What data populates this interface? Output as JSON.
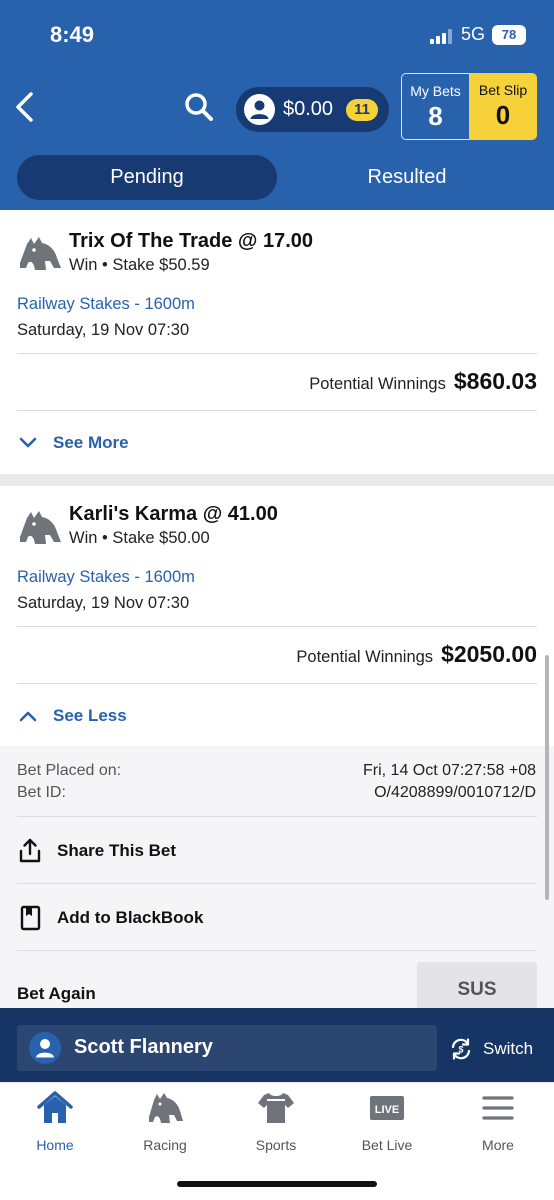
{
  "status_bar": {
    "time": "8:49",
    "network": "5G",
    "battery": "78"
  },
  "header": {
    "balance": "$0.00",
    "balance_badge": "11",
    "my_bets": {
      "label": "My Bets",
      "count": "8"
    },
    "bet_slip": {
      "label": "Bet Slip",
      "count": "0"
    }
  },
  "tabs": [
    {
      "label": "Pending",
      "active": true
    },
    {
      "label": "Resulted",
      "active": false
    }
  ],
  "bets": [
    {
      "title": "Trix Of The Trade @ 17.00",
      "bet_type": "Win",
      "stake": "Stake $50.59",
      "race": "Railway Stakes - 1600m",
      "date": "Saturday, 19 Nov 07:30",
      "potential_label": "Potential Winnings",
      "potential_value": "$860.03",
      "toggle_label": "See More"
    },
    {
      "title": "Karli's Karma @ 41.00",
      "bet_type": "Win",
      "stake": "Stake $50.00",
      "race": "Railway Stakes - 1600m",
      "date": "Saturday, 19 Nov 07:30",
      "potential_label": "Potential Winnings",
      "potential_value": "$2050.00",
      "toggle_label": "See Less"
    }
  ],
  "details": {
    "placed_label": "Bet Placed on:",
    "placed_value": "Fri, 14 Oct 07:27:58 +08",
    "id_label": "Bet ID:",
    "id_value": "O/4208899/0010712/D",
    "share_label": "Share This Bet",
    "blackbook_label": "Add to BlackBook",
    "bet_again_label": "Bet Again",
    "sus_label": "SUS"
  },
  "account": {
    "name": "Scott Flannery",
    "switch_label": "Switch"
  },
  "bottom_nav": [
    {
      "label": "Home",
      "icon": "home-icon",
      "active": true
    },
    {
      "label": "Racing",
      "icon": "horse-icon",
      "active": false
    },
    {
      "label": "Sports",
      "icon": "jersey-icon",
      "active": false
    },
    {
      "label": "Bet Live",
      "icon": "live-icon",
      "active": false
    },
    {
      "label": "More",
      "icon": "menu-icon",
      "active": false
    }
  ],
  "colors": {
    "brand_blue": "#2862ad",
    "dark_navy": "#173a72",
    "accent_yellow": "#f7d13a"
  }
}
